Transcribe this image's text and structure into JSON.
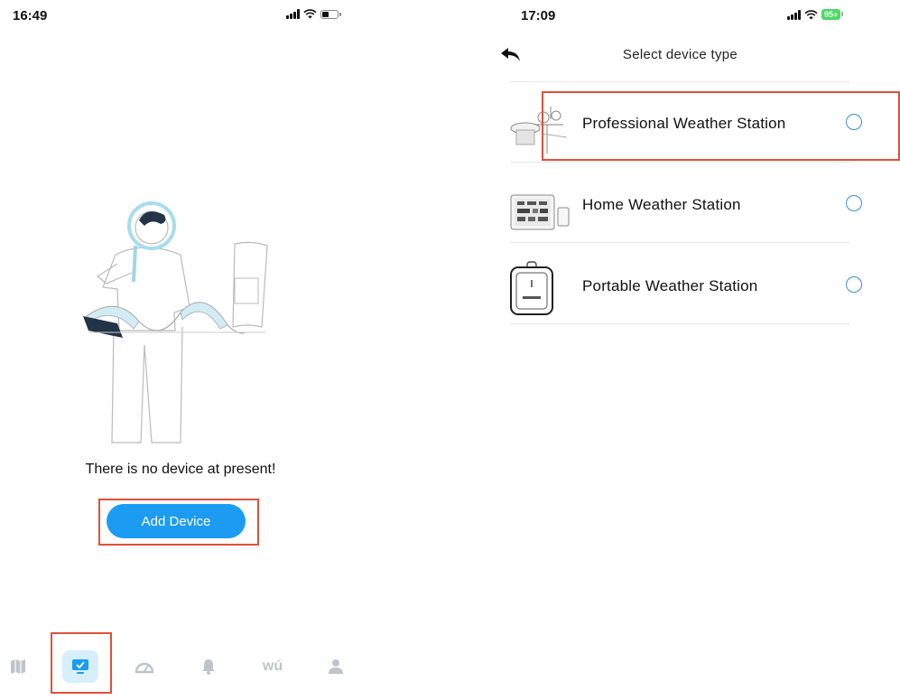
{
  "left_screen": {
    "status_time": "16:49",
    "empty_message": "There is no device at present!",
    "add_device_label": "Add Device",
    "tabs": [
      {
        "icon": "map-icon",
        "active": false
      },
      {
        "icon": "device-monitor-icon",
        "active": true
      },
      {
        "icon": "dashboard-gauge-icon",
        "active": false
      },
      {
        "icon": "bell-icon",
        "active": false
      },
      {
        "icon": "wu-logo-icon",
        "label": "wú",
        "active": false
      },
      {
        "icon": "user-icon",
        "active": false
      }
    ]
  },
  "right_screen": {
    "status_time": "17:09",
    "battery_label": "95+",
    "title": "Select device type",
    "devices": [
      {
        "name": "Professional Weather Station",
        "icon": "professional-weather-station-image",
        "selected": false
      },
      {
        "name": "Home Weather Station",
        "icon": "home-weather-station-image",
        "selected": false
      },
      {
        "name": "Portable Weather Station",
        "icon": "portable-weather-station-image",
        "selected": false
      }
    ]
  },
  "colors": {
    "accent": "#1b9cf2",
    "highlight_box": "#e0503a",
    "active_tab_bg": "#d6effc",
    "radio_border": "#3b8ed6",
    "battery_green": "#4cd964"
  }
}
